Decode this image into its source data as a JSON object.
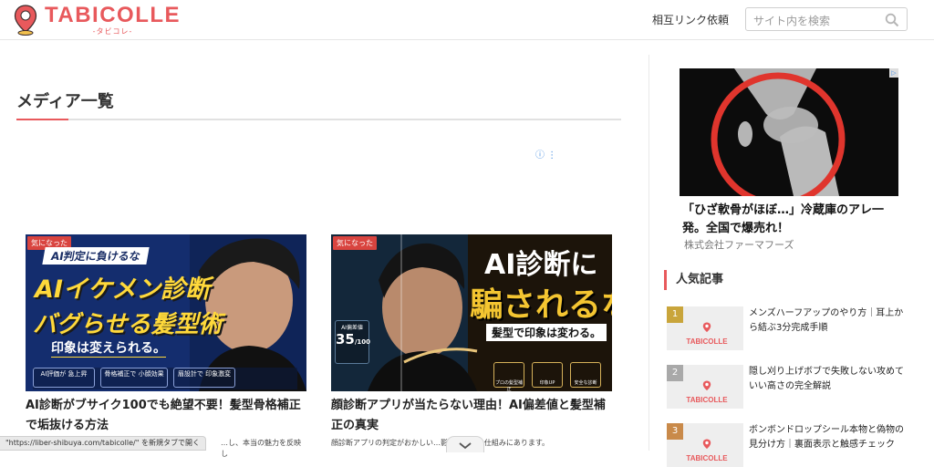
{
  "header": {
    "logo_main": "TABICOLLE",
    "logo_sub": "-タビコレ-",
    "mutual_link": "相互リンク依頼",
    "search_placeholder": "サイト内を検索"
  },
  "main": {
    "page_title": "メディア一覧",
    "adchoices": "ⓘ ⋮",
    "cards": [
      {
        "badge": "気になった",
        "title": "AI診断がブサイク100でも絶望不要！髪型骨格補正で垢抜ける方法",
        "excerpt": "…し、本当の魅力を反映し",
        "hero": {
          "line1": "AI判定に負けるな",
          "line2": "AIイケメン診断",
          "line3": "バグらせる髪型術",
          "line4": "印象は変えられる。",
          "chips": [
            "AI評価が 急上昇",
            "骨格補正で 小顔効果",
            "眉設計で 印象激変"
          ]
        }
      },
      {
        "badge": "気になった",
        "title": "顔診断アプリが当たらない理由！AI偏差値と髪型補正の真実",
        "excerpt": "顔診断アプリの判定がおかしい…影環境とAIの仕組みにあります。",
        "hero": {
          "line1": "AI診断に",
          "line2": "騙されるな",
          "line3": "髪型で印象は変わる。",
          "score": "35",
          "score_total": "/100",
          "score_caption": "AI偏差値",
          "chips": [
            "プロの髪型補正",
            "印象UP",
            "安全な診断"
          ]
        }
      }
    ]
  },
  "sidebar": {
    "ad_title": "「ひざ軟骨がほぼ…」冷蔵庫のアレ一発。全国で爆売れ！",
    "ad_sponsor": "株式会社ファーマフーズ",
    "popular_heading": "人気記事",
    "popular": [
      {
        "rank": "1",
        "rank_color": "#c9a53b",
        "title": "メンズハーフアップのやり方｜耳上から結ぶ3分完成手順"
      },
      {
        "rank": "2",
        "rank_color": "#a9a9a9",
        "title": "隠し刈り上げボブで失敗しない攻めていい高さの完全解説"
      },
      {
        "rank": "3",
        "rank_color": "#c98a4a",
        "title": "ボンボンドロップシール本物と偽物の見分け方｜裏面表示と触感チェック"
      }
    ],
    "thumb_logo": "TABICOLLE"
  },
  "status": {
    "url_hint": "\"https://liber-shibuya.com/tabicolle/\" を新規タブで開く"
  }
}
